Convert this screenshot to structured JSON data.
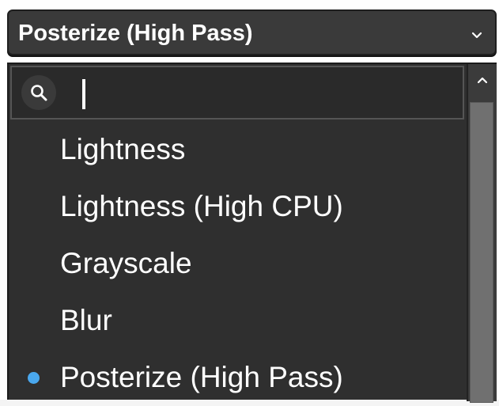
{
  "select": {
    "value": "Posterize (High Pass)",
    "icon": "chevron-down-icon"
  },
  "search": {
    "value": "",
    "placeholder": "",
    "icon": "search-icon"
  },
  "options": [
    {
      "label": "Lightness",
      "selected": false
    },
    {
      "label": "Lightness (High CPU)",
      "selected": false
    },
    {
      "label": "Grayscale",
      "selected": false
    },
    {
      "label": "Blur",
      "selected": false
    },
    {
      "label": "Posterize (High Pass)",
      "selected": true
    }
  ],
  "colors": {
    "background": "#2f2f2f",
    "text": "#ffffff",
    "selected_dot": "#4aa8ee"
  }
}
